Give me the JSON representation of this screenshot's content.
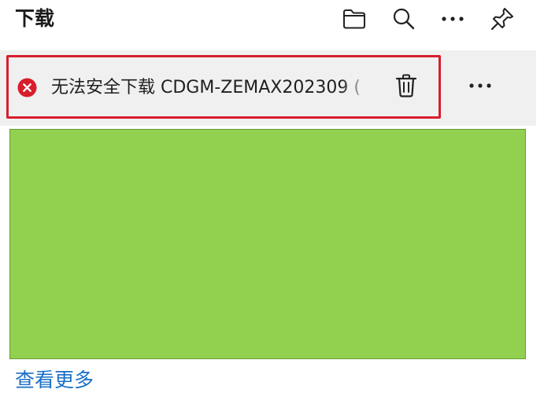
{
  "header": {
    "title": "下载",
    "icons": {
      "folder": "folder-icon",
      "search": "search-icon",
      "more": "more-icon",
      "pin": "pin-icon"
    }
  },
  "download_item": {
    "status_icon": "error-icon",
    "text": "无法安全下载 CDGM-ZEMAX202309 (",
    "actions": {
      "delete": "trash-icon",
      "more": "more-icon"
    }
  },
  "footer": {
    "see_more_label": "查看更多"
  },
  "colors": {
    "error": "#d81e2c",
    "highlight_border": "#d81e2c",
    "link": "#1a6fc7",
    "green_block": "#92d050",
    "row_background": "#f0f0f0"
  }
}
